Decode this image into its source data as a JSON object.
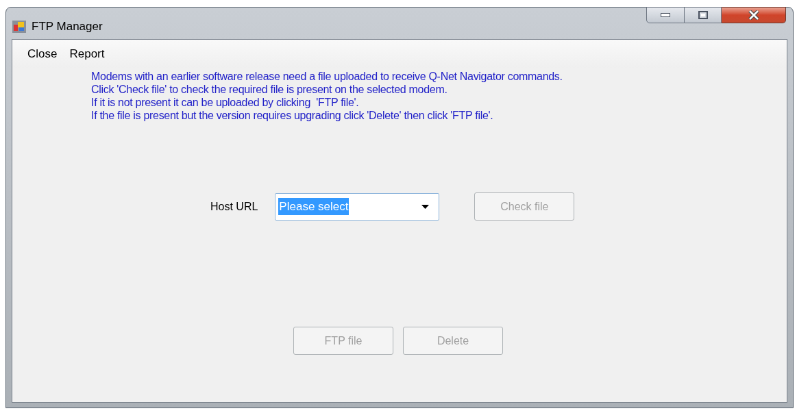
{
  "window": {
    "title": "FTP Manager"
  },
  "menu": [
    {
      "label": "Close"
    },
    {
      "label": "Report"
    }
  ],
  "instructions": [
    "Modems with an earlier software release need a file uploaded to receive Q-Net Navigator commands.",
    "Click 'Check file' to check the required file is present on the selected modem.",
    "If it is not present it can be uploaded by clicking  'FTP file'.",
    "If the file is present but the version requires upgrading click 'Delete' then click 'FTP file'."
  ],
  "host_url": {
    "label": "Host URL",
    "value": "Please select",
    "text_selected": true
  },
  "check_button": {
    "label": "Check file",
    "disabled": true
  },
  "action_buttons": [
    {
      "label": "FTP file",
      "disabled": true
    },
    {
      "label": "Delete",
      "disabled": true
    }
  ]
}
